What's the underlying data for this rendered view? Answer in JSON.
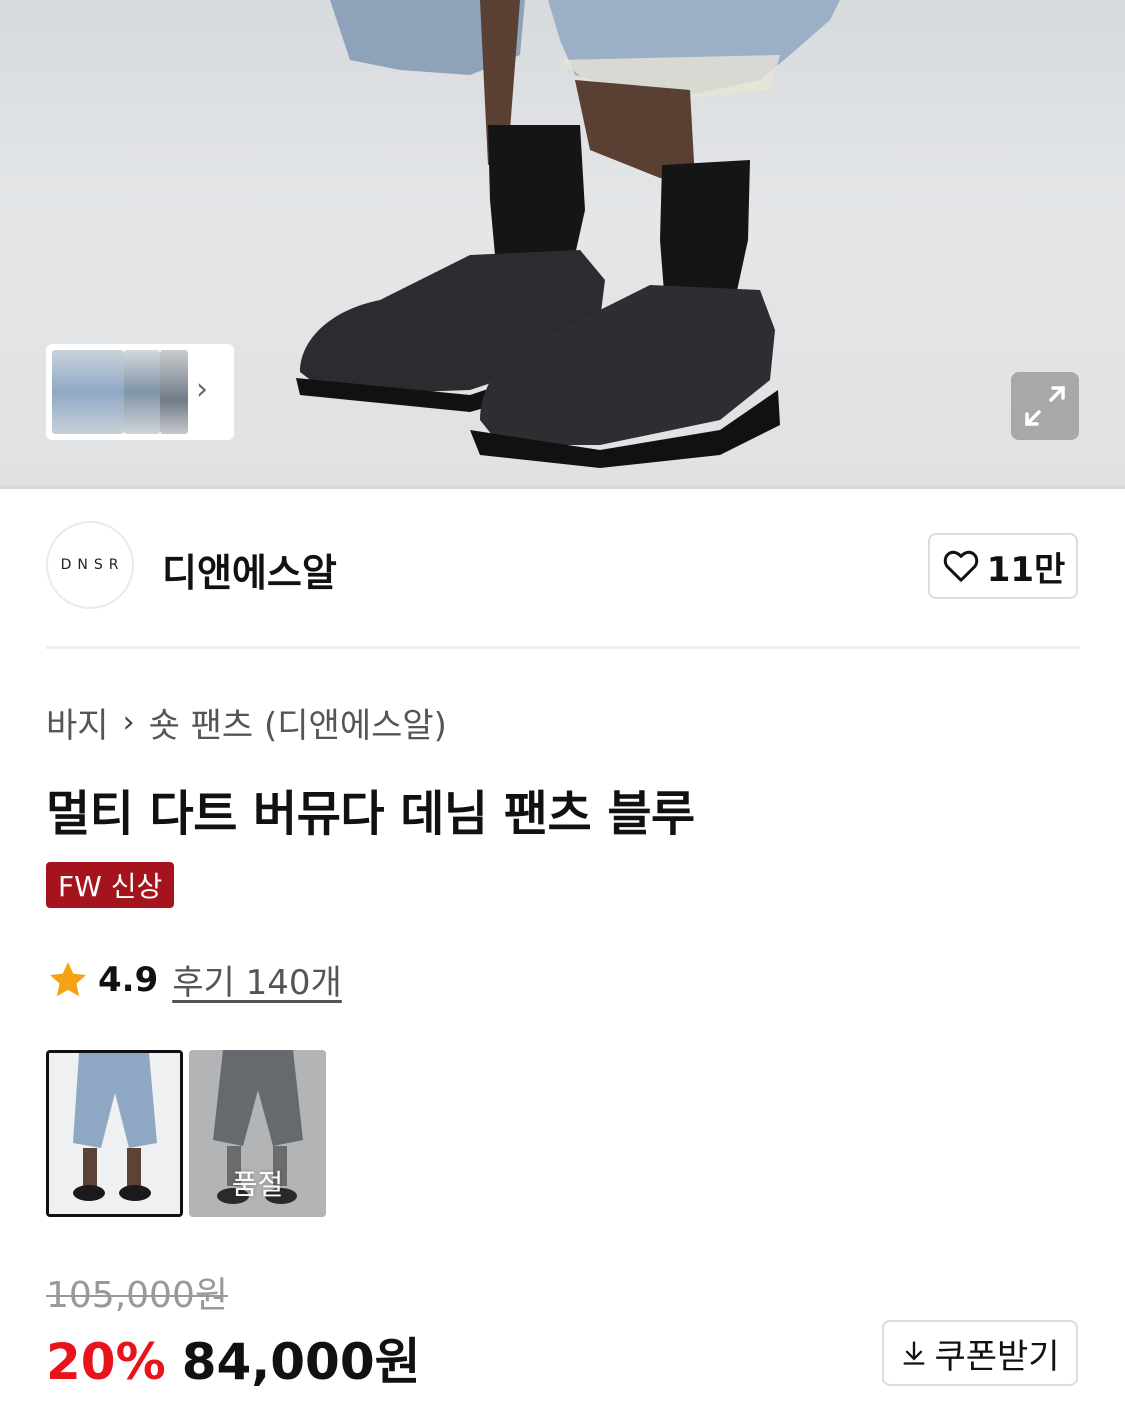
{
  "brand": {
    "logo_text": "DNSR",
    "name": "디앤에스알",
    "like_count": "11만"
  },
  "breadcrumb": {
    "category": "바지",
    "subcategory": "숏 팬츠 (디앤에스알)"
  },
  "product": {
    "title": "멀티 다트 버뮤다 데님 팬츠 블루",
    "badge": "FW 신상",
    "rating": "4.9",
    "reviews_label": "후기 140개"
  },
  "options": [
    {
      "color": "blue",
      "selected": true,
      "soldout_label": ""
    },
    {
      "color": "gray",
      "selected": false,
      "soldout_label": "품절"
    }
  ],
  "price": {
    "original": "105,000원",
    "discount": "20%",
    "final": "84,000원"
  },
  "coupon": {
    "label": "쿠폰받기"
  },
  "colors": {
    "badge_bg": "#a5141c",
    "discount": "#e8141c",
    "star": "#f5a214"
  },
  "icons": [
    "chevron-right-icon",
    "expand-icon",
    "heart-icon",
    "star-icon",
    "download-icon"
  ]
}
